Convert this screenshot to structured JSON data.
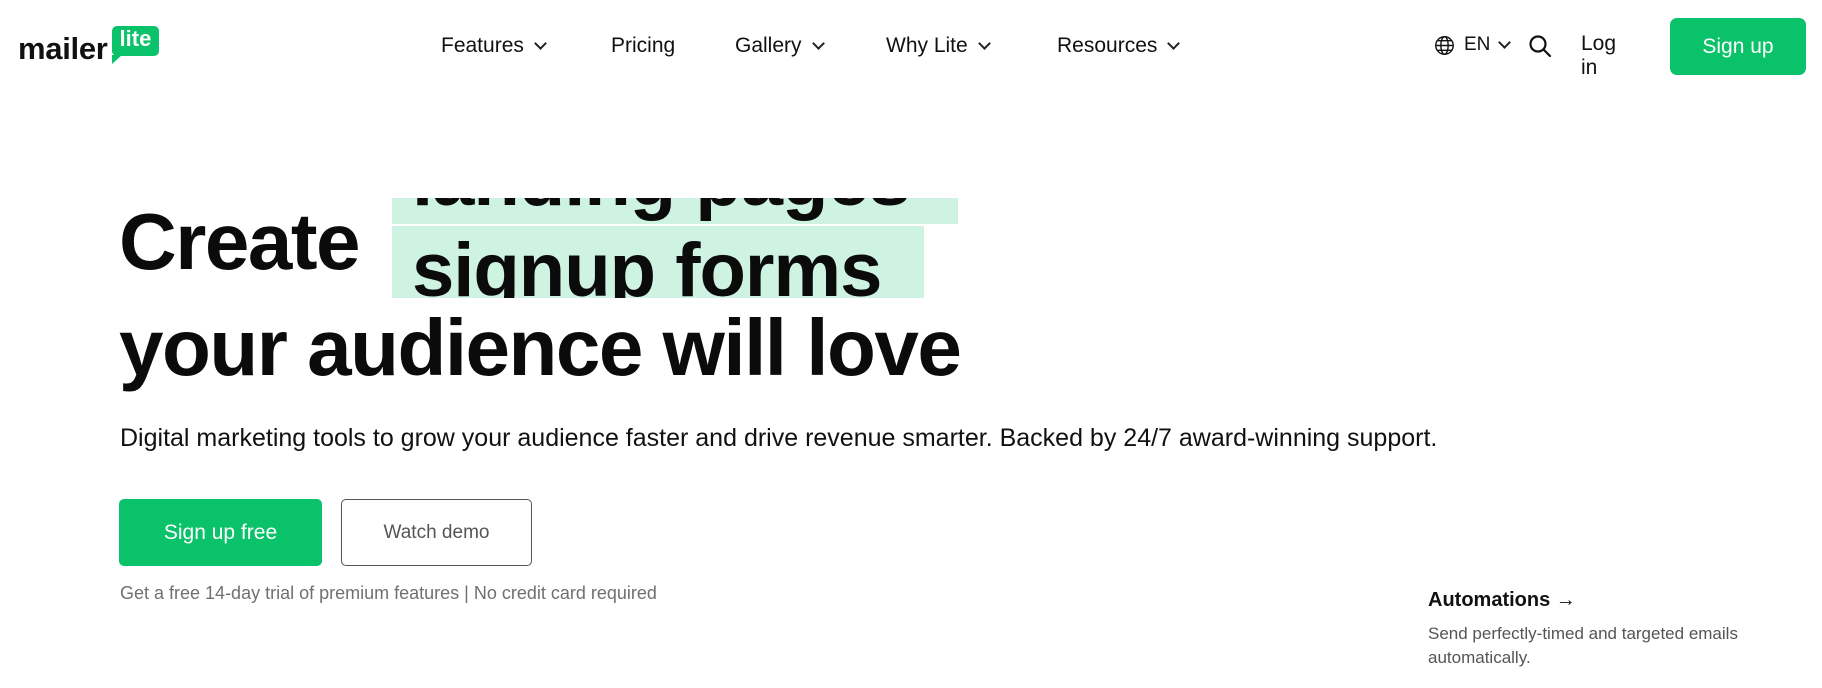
{
  "header": {
    "logo": {
      "word": "mailer",
      "badge": "lite"
    },
    "nav": [
      {
        "label": "Features",
        "has_dropdown": true
      },
      {
        "label": "Pricing",
        "has_dropdown": false
      },
      {
        "label": "Gallery",
        "has_dropdown": true
      },
      {
        "label": "Why Lite",
        "has_dropdown": true
      },
      {
        "label": "Resources",
        "has_dropdown": true
      }
    ],
    "language": "EN",
    "login_label": "Log in",
    "signup_label": "Sign up"
  },
  "hero": {
    "line1": "Create",
    "rotating_prev": "landing pages",
    "rotating_current": "signup forms",
    "line2": "your audience will love",
    "subtitle": "Digital marketing tools to grow your audience faster and drive revenue smarter. Backed by 24/7 award-winning support.",
    "primary_cta": "Sign up free",
    "secondary_cta": "Watch demo",
    "trial_note": "Get a free 14-day trial of premium features | No credit card required"
  },
  "feature_card": {
    "title": "Automations",
    "arrow": "→",
    "description": "Send perfectly-timed and targeted emails automatically."
  },
  "colors": {
    "brand_green": "#09c269",
    "highlight": "#cff3e2",
    "text": "#111111",
    "muted": "#707070"
  }
}
